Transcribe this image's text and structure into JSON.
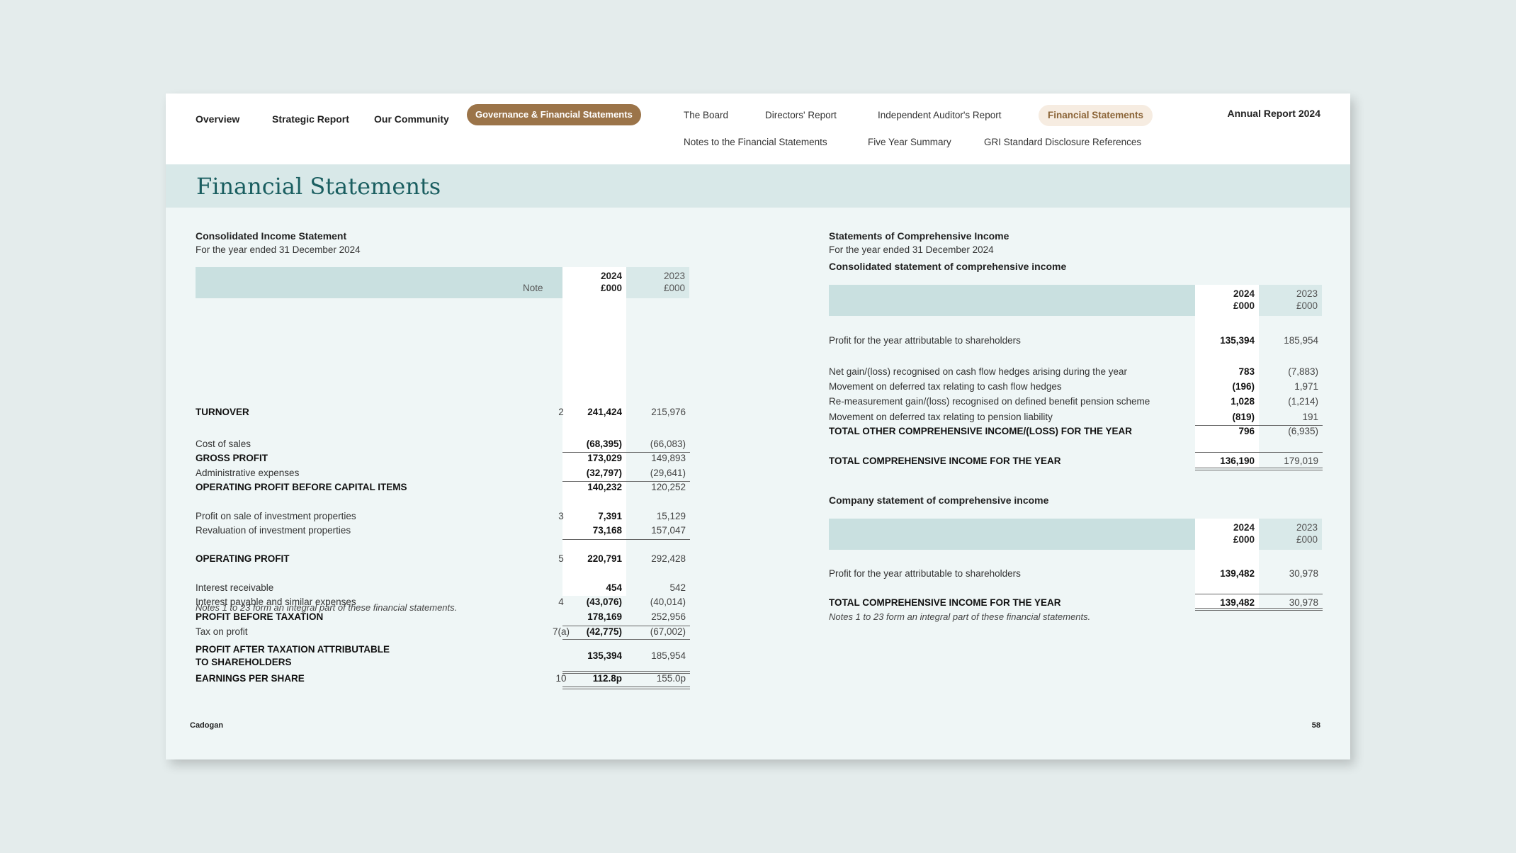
{
  "nav": {
    "main": [
      "Overview",
      "Strategic Report",
      "Our Community"
    ],
    "active_main": "Governance & Financial Statements",
    "sub_row1": [
      "The Board",
      "Directors' Report",
      "Independent Auditor's Report"
    ],
    "active_sub": "Financial Statements",
    "sub_row2": [
      "Notes to the Financial Statements",
      "Five Year Summary",
      "GRI Standard Disclosure References"
    ],
    "annual_report": "Annual Report 2024"
  },
  "page_title": "Financial Statements",
  "left": {
    "title": "Consolidated Income Statement",
    "subtitle": "For the year ended 31 December 2024",
    "header": {
      "note": "Note",
      "cur_year": "2024",
      "cur_unit": "£000",
      "prev_year": "2023",
      "prev_unit": "£000"
    },
    "rows": [
      {
        "label": "TURNOVER",
        "note": "2",
        "cur": "241,424",
        "prev": "215,976",
        "bold": true
      },
      {
        "label": "Cost of sales",
        "note": "",
        "cur": "(68,395)",
        "prev": "(66,083)",
        "bold": false
      },
      {
        "label": "GROSS PROFIT",
        "note": "",
        "cur": "173,029",
        "prev": "149,893",
        "bold": true
      },
      {
        "label": "Administrative expenses",
        "note": "",
        "cur": "(32,797)",
        "prev": "(29,641)",
        "bold": false
      },
      {
        "label": "OPERATING PROFIT BEFORE CAPITAL ITEMS",
        "note": "",
        "cur": "140,232",
        "prev": "120,252",
        "bold": true
      },
      {
        "label": "Profit on sale of investment properties",
        "note": "3",
        "cur": "7,391",
        "prev": "15,129",
        "bold": false
      },
      {
        "label": "Revaluation of investment properties",
        "note": "",
        "cur": "73,168",
        "prev": "157,047",
        "bold": false
      },
      {
        "label": "OPERATING PROFIT",
        "note": "5",
        "cur": "220,791",
        "prev": "292,428",
        "bold": true
      },
      {
        "label": "Interest receivable",
        "note": "",
        "cur": "454",
        "prev": "542",
        "bold": false
      },
      {
        "label": "Interest payable and similar expenses",
        "note": "4",
        "cur": "(43,076)",
        "prev": "(40,014)",
        "bold": false
      },
      {
        "label": "PROFIT BEFORE TAXATION",
        "note": "",
        "cur": "178,169",
        "prev": "252,956",
        "bold": true
      },
      {
        "label": "Tax on profit",
        "note": "7(a)",
        "cur": "(42,775)",
        "prev": "(67,002)",
        "bold": false
      },
      {
        "label": "PROFIT AFTER TAXATION ATTRIBUTABLE",
        "label2": "TO SHAREHOLDERS",
        "note": "",
        "cur": "135,394",
        "prev": "185,954",
        "bold": true
      },
      {
        "label": "EARNINGS PER SHARE",
        "note": "10",
        "cur": "112.8p",
        "prev": "155.0p",
        "bold": true
      }
    ],
    "footnote": "Notes 1 to 23 form an integral part of these financial statements."
  },
  "right": {
    "title": "Statements of Comprehensive Income",
    "subtitle": "For the year ended 31 December 2024",
    "consolidated": {
      "heading": "Consolidated statement of comprehensive income",
      "header": {
        "cur_year": "2024",
        "cur_unit": "£000",
        "prev_year": "2023",
        "prev_unit": "£000"
      },
      "rows": [
        {
          "label": "Profit for the year attributable to shareholders",
          "cur": "135,394",
          "prev": "185,954",
          "bold": false
        },
        {
          "label": "Net gain/(loss) recognised on cash flow hedges arising during the year",
          "cur": "783",
          "prev": "(7,883)",
          "bold": false
        },
        {
          "label": "Movement on deferred tax relating to cash flow hedges",
          "cur": "(196)",
          "prev": "1,971",
          "bold": false
        },
        {
          "label": "Re-measurement gain/(loss) recognised on defined benefit pension scheme",
          "cur": "1,028",
          "prev": "(1,214)",
          "bold": false
        },
        {
          "label": "Movement on deferred tax relating to pension liability",
          "cur": "(819)",
          "prev": "191",
          "bold": false
        },
        {
          "label": "TOTAL OTHER COMPREHENSIVE INCOME/(LOSS) FOR THE YEAR",
          "cur": "796",
          "prev": "(6,935)",
          "bold": true
        },
        {
          "label": "TOTAL COMPREHENSIVE INCOME FOR THE YEAR",
          "cur": "136,190",
          "prev": "179,019",
          "bold": true
        }
      ]
    },
    "company": {
      "heading": "Company statement of comprehensive income",
      "header": {
        "cur_year": "2024",
        "cur_unit": "£000",
        "prev_year": "2023",
        "prev_unit": "£000"
      },
      "rows": [
        {
          "label": "Profit for the year attributable to shareholders",
          "cur": "139,482",
          "prev": "30,978",
          "bold": false
        },
        {
          "label": "TOTAL COMPREHENSIVE INCOME FOR THE YEAR",
          "cur": "139,482",
          "prev": "30,978",
          "bold": true
        }
      ]
    },
    "footnote": "Notes 1 to 23 form an integral part of these financial statements."
  },
  "footer": {
    "brand": "Cadogan",
    "page_number": "58"
  }
}
